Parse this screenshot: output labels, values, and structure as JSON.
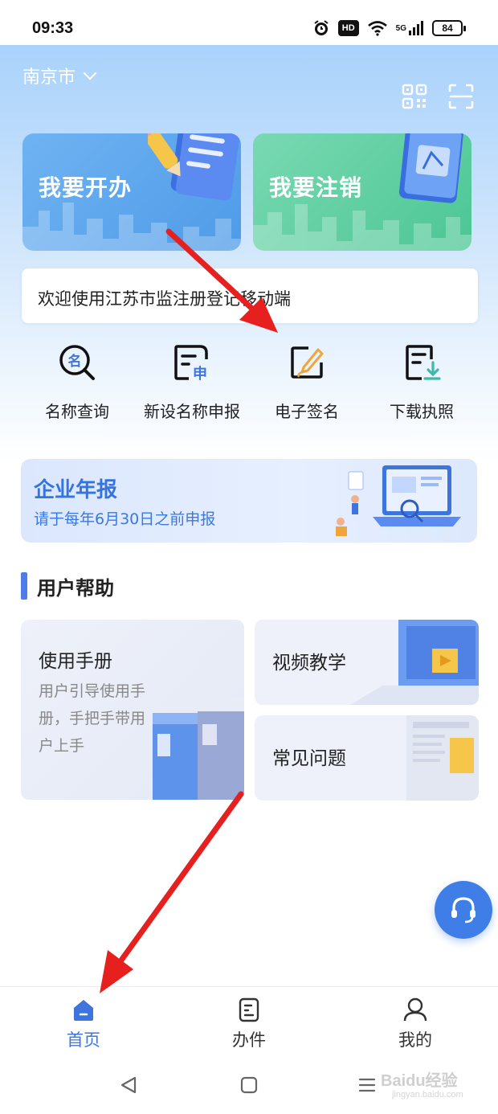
{
  "status_bar": {
    "time": "09:33",
    "hd": "HD",
    "network": "5G",
    "battery": "84"
  },
  "header": {
    "city": "南京市"
  },
  "cards": {
    "open_label": "我要开办",
    "cancel_label": "我要注销"
  },
  "welcome": "欢迎使用江苏市监注册登记移动端",
  "quick_actions": [
    {
      "label": "名称查询",
      "icon": "name-search-icon"
    },
    {
      "label": "新设名称申报",
      "icon": "new-name-apply-icon"
    },
    {
      "label": "电子签名",
      "icon": "e-signature-icon"
    },
    {
      "label": "下载执照",
      "icon": "download-license-icon"
    }
  ],
  "annual_report": {
    "title": "企业年报",
    "subtitle": "请于每年6月30日之前申报"
  },
  "help": {
    "section_title": "用户帮助",
    "manual_title": "使用手册",
    "manual_desc": "用户引导使用手册，手把手带用户上手",
    "video_title": "视频教学",
    "faq_title": "常见问题"
  },
  "tabbar": [
    {
      "label": "首页",
      "icon": "home-icon",
      "active": true
    },
    {
      "label": "办件",
      "icon": "document-icon",
      "active": false
    },
    {
      "label": "我的",
      "icon": "user-icon",
      "active": false
    }
  ],
  "watermark": {
    "text": "Baidu经验",
    "sub": "jingyan.baidu.com"
  },
  "colors": {
    "accent": "#3d74de",
    "open_card": "#4f9be8",
    "cancel_card": "#4cc694",
    "arrow": "#e5201f"
  }
}
